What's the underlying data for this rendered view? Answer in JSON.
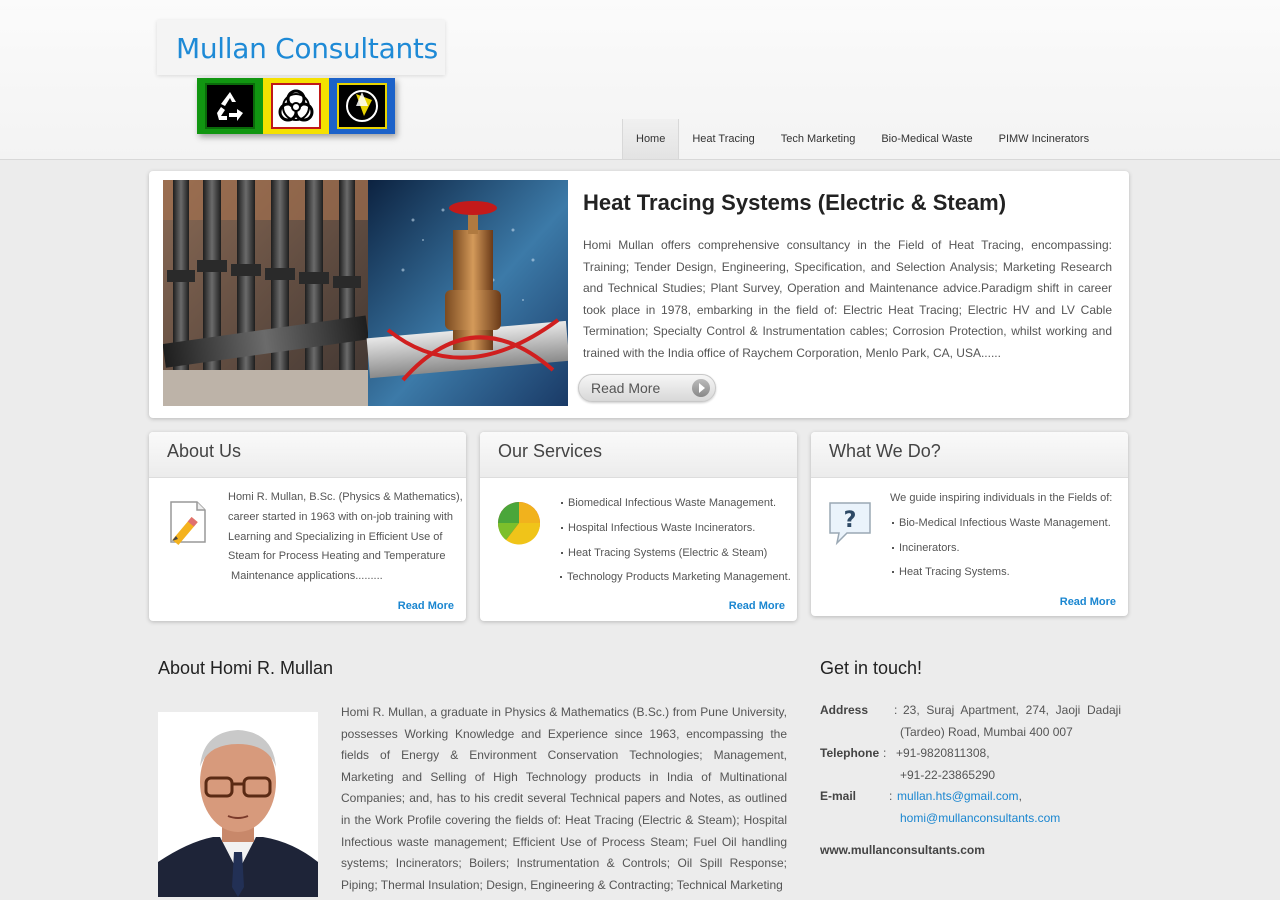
{
  "brand": {
    "title": "Mullan Consultants"
  },
  "logo_icons": [
    "recycle-icon",
    "biohazard-icon",
    "reduce-reuse-recycle-icon"
  ],
  "nav": {
    "items": [
      {
        "label": "Home",
        "active": true
      },
      {
        "label": "Heat Tracing"
      },
      {
        "label": "Tech Marketing"
      },
      {
        "label": "Bio-Medical Waste"
      },
      {
        "label": "PIMW Incinerators"
      }
    ]
  },
  "feature": {
    "title": "Heat Tracing Systems (Electric & Steam)",
    "text": "Homi Mullan offers comprehensive consultancy in the Field of Heat Tracing, encompassing: Training; Tender Design, Engineering, Specification, and Selection Analysis; Marketing Research and Technical Studies; Plant Survey, Operation and Maintenance advice.Paradigm shift in career took place in 1978, embarking in the field of: Electric Heat Tracing; Electric HV and LV Cable Termination; Specialty Control & Instrumentation cables; Corrosion Protection, whilst working and trained with the India office of Raychem Corporation, Menlo Park, CA, USA......",
    "button": "Read More"
  },
  "about": {
    "title": "About Us",
    "lines": [
      "Homi R. Mullan, B.Sc. (Physics & Mathematics),",
      "career started in 1963 with on-job training with",
      "Learning and Specializing in Efficient Use of",
      "Steam for Process Heating and Temperature",
      " Maintenance applications........."
    ],
    "read_more": "Read More"
  },
  "services": {
    "title": "Our Services",
    "items": [
      "Biomedical Infectious Waste Management.",
      "Hospital Infectious Waste Incinerators.",
      "Heat Tracing Systems (Electric & Steam)",
      "Technology Products Marketing Management."
    ],
    "read_more": "Read More"
  },
  "whatwedo": {
    "title": "What We Do?",
    "intro": "We guide inspiring individuals in the Fields of:",
    "items": [
      "Bio-Medical Infectious Waste Management.",
      "Incinerators.",
      "Heat Tracing Systems."
    ],
    "read_more": "Read More"
  },
  "bio": {
    "title": "About Homi R. Mullan",
    "text": "Homi R. Mullan, a graduate in Physics & Mathematics (B.Sc.) from Pune University, possesses Working Knowledge and Experience since 1963, encompassing the fields of Energy & Environment Conservation Technologies; Management, Marketing and Selling of High Technology products in India of Multinational Companies; and, has to his credit several Technical papers and Notes, as outlined in the Work Profile covering the fields of: Heat Tracing (Electric & Steam); Hospital Infectious waste management; Efficient Use of Process Steam; Fuel Oil handling systems; Incinerators; Boilers; Instrumentation & Controls; Oil Spill Response; Piping; Thermal Insulation; Design, Engineering & Contracting; Technical Marketing"
  },
  "contact": {
    "title": "Get in touch!",
    "address_label": "Address",
    "address_line1": "23, Suraj Apartment, 274, Jaoji Dadaji",
    "address_line2": "(Tardeo) Road, Mumbai 400 007",
    "phone_label": "Telephone",
    "phone1": "+91-9820811308,",
    "phone2": "+91-22-23865290",
    "email_label": "E-mail",
    "email1": "mullan.hts@gmail.com",
    "email1_suffix": ",",
    "email2": "homi@mullanconsultants.com",
    "website": "www.mullanconsultants.com"
  },
  "colors": {
    "accent": "#1a86d0",
    "brand": "#1e8ad6"
  }
}
